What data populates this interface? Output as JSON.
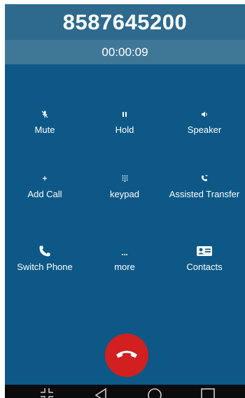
{
  "call": {
    "number": "8587645200",
    "duration": "00:00:09"
  },
  "actions": {
    "mute": {
      "label": "Mute",
      "icon": "mic-off-icon"
    },
    "hold": {
      "label": "Hold",
      "icon": "pause-icon"
    },
    "speaker": {
      "label": "Speaker",
      "icon": "speaker-icon"
    },
    "add_call": {
      "label": "Add Call",
      "icon": "plus-icon"
    },
    "keypad": {
      "label": "keypad",
      "icon": "dialpad-icon"
    },
    "assisted_transfer": {
      "label": "Assisted Transfer",
      "icon": "phone-forward-icon"
    },
    "switch_phone": {
      "label": "Switch Phone",
      "icon": "phone-icon"
    },
    "more": {
      "label": "more",
      "icon": "more-dots-icon"
    },
    "contacts": {
      "label": "Contacts",
      "icon": "contact-card-icon"
    }
  },
  "end_call": {
    "icon": "phone-hangup-icon"
  },
  "navigation": {
    "icons": [
      "collapse-icon",
      "back-icon",
      "home-icon",
      "recents-icon"
    ]
  },
  "colors": {
    "header": "#2e6a8e",
    "timer_bar": "#3f7797",
    "background": "#0d5886",
    "end_call": "#d21f1f",
    "nav_bar": "#0b0b0b"
  }
}
